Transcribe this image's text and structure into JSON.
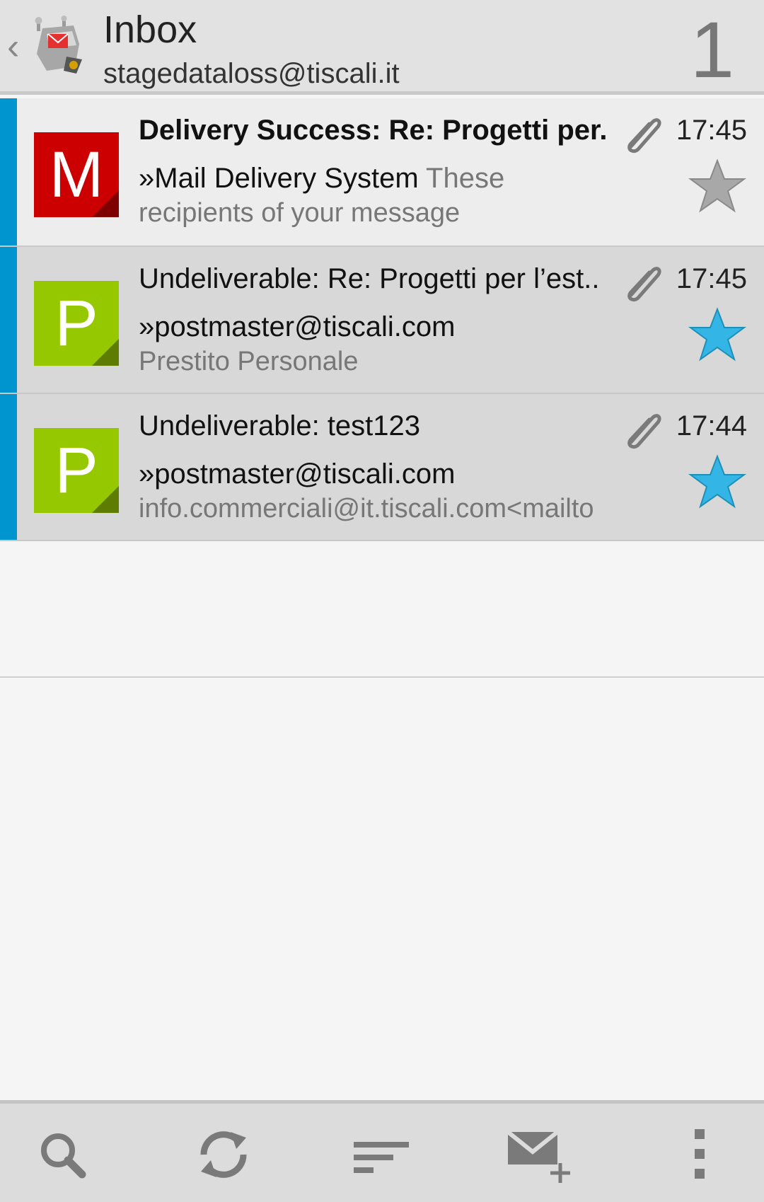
{
  "header": {
    "back_glyph": "‹",
    "title": "Inbox",
    "account": "stagedataloss@tiscali.it",
    "unread_count": "1"
  },
  "messages": [
    {
      "avatar_letter": "M",
      "avatar_color": "#cc0000",
      "subject": "Delivery Success: Re: Progetti per..",
      "subject_bold": true,
      "time": "17:45",
      "sender": "»Mail Delivery System",
      "preview_inline": "These",
      "preview_line2": "recipients of your message",
      "starred": false,
      "has_attachment": true,
      "unread": true
    },
    {
      "avatar_letter": "P",
      "avatar_color": "#96c800",
      "subject": "Undeliverable: Re: Progetti per l’est..",
      "subject_bold": false,
      "time": "17:45",
      "sender": "»postmaster@tiscali.com",
      "preview_inline": "",
      "preview_line2": "Prestito Personale",
      "starred": true,
      "has_attachment": true,
      "unread": true
    },
    {
      "avatar_letter": "P",
      "avatar_color": "#96c800",
      "subject": "Undeliverable: test123",
      "subject_bold": false,
      "time": "17:44",
      "sender": "»postmaster@tiscali.com",
      "preview_inline": "",
      "preview_line2": "info.commerciali@it.tiscali.com<mailto",
      "starred": true,
      "has_attachment": true,
      "unread": true
    }
  ],
  "toolbar": {
    "icons": [
      "search-icon",
      "refresh-icon",
      "sort-icon",
      "compose-icon",
      "overflow-menu-icon"
    ]
  },
  "colors": {
    "unread_bar": "#0095cf",
    "star_active": "#33b5e5",
    "star_inactive": "#a8a8a8"
  }
}
